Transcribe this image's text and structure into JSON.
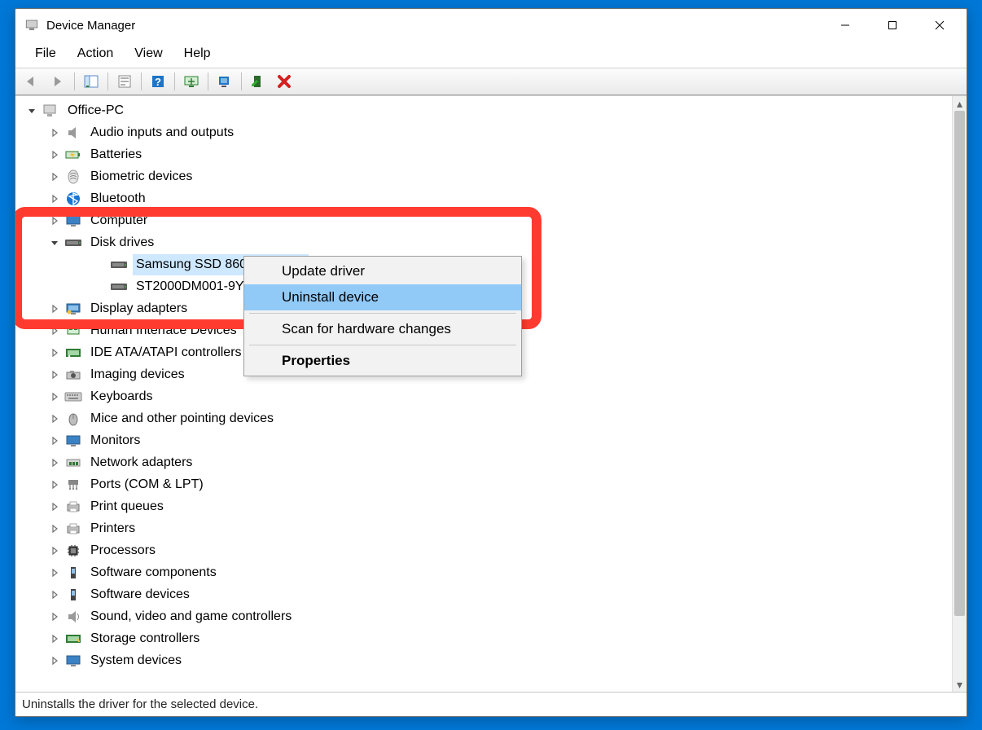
{
  "window": {
    "title": "Device Manager"
  },
  "menu": {
    "file": "File",
    "action": "Action",
    "view": "View",
    "help": "Help"
  },
  "status": {
    "text": "Uninstalls the driver for the selected device."
  },
  "context_menu": {
    "update": "Update driver",
    "uninstall": "Uninstall device",
    "scan": "Scan for hardware changes",
    "properties": "Properties"
  },
  "tree": {
    "root": "Office-PC",
    "items": [
      {
        "label": "Audio inputs and outputs",
        "icon": "audio"
      },
      {
        "label": "Batteries",
        "icon": "battery"
      },
      {
        "label": "Biometric devices",
        "icon": "biometric"
      },
      {
        "label": "Bluetooth",
        "icon": "bluetooth"
      },
      {
        "label": "Computer",
        "icon": "computer"
      },
      {
        "label": "Disk drives",
        "icon": "disk",
        "expanded": true,
        "children": [
          {
            "label": "Samsung SSD 860 EVO 1TB",
            "icon": "disk",
            "selected": true
          },
          {
            "label": "ST2000DM001-9YN1",
            "icon": "disk"
          }
        ]
      },
      {
        "label": "Display adapters",
        "icon": "display"
      },
      {
        "label": "Human Interface Devices",
        "icon": "hid"
      },
      {
        "label": "IDE ATA/ATAPI controllers",
        "icon": "ide"
      },
      {
        "label": "Imaging devices",
        "icon": "imaging"
      },
      {
        "label": "Keyboards",
        "icon": "keyboard"
      },
      {
        "label": "Mice and other pointing devices",
        "icon": "mouse"
      },
      {
        "label": "Monitors",
        "icon": "monitor"
      },
      {
        "label": "Network adapters",
        "icon": "network"
      },
      {
        "label": "Ports (COM & LPT)",
        "icon": "ports"
      },
      {
        "label": "Print queues",
        "icon": "printq"
      },
      {
        "label": "Printers",
        "icon": "printer"
      },
      {
        "label": "Processors",
        "icon": "cpu"
      },
      {
        "label": "Software components",
        "icon": "swc"
      },
      {
        "label": "Software devices",
        "icon": "swd"
      },
      {
        "label": "Sound, video and game controllers",
        "icon": "sound"
      },
      {
        "label": "Storage controllers",
        "icon": "storage"
      },
      {
        "label": "System devices",
        "icon": "sys"
      }
    ]
  }
}
